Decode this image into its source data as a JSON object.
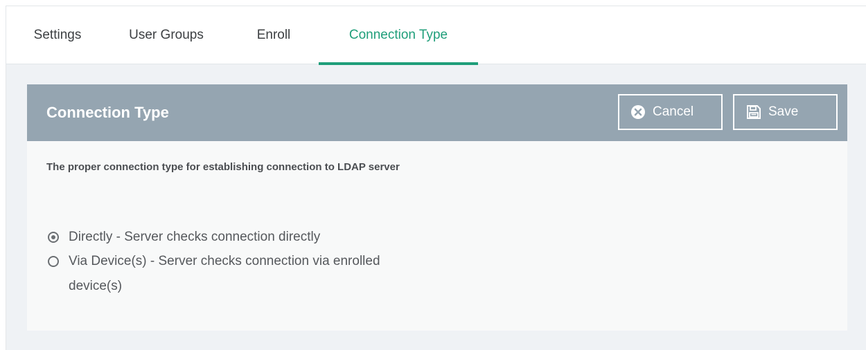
{
  "tabs": [
    {
      "label": "Settings",
      "active": false
    },
    {
      "label": "User Groups",
      "active": false
    },
    {
      "label": "Enroll",
      "active": false
    },
    {
      "label": "Connection Type",
      "active": true
    }
  ],
  "panel": {
    "title": "Connection Type",
    "cancel_label": "Cancel",
    "save_label": "Save",
    "cancel_icon": "close-circle-icon",
    "save_icon": "floppy-disk-icon",
    "description": "The proper connection type for establishing connection to LDAP server",
    "options": [
      {
        "label": "Directly - Server checks connection directly",
        "selected": true
      },
      {
        "label": "Via Device(s) - Server checks connection via enrolled device(s)",
        "selected": false
      }
    ]
  },
  "colors": {
    "accent": "#1f9e7a",
    "header": "#95a5b1",
    "background": "#eff2f5"
  }
}
